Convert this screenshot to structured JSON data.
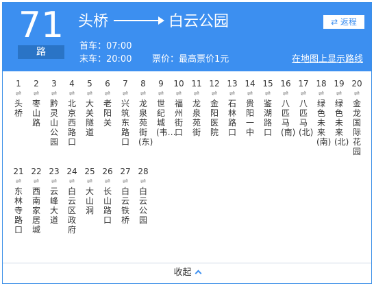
{
  "header": {
    "route_number": "71",
    "route_suffix": "路",
    "from": "头桥",
    "to": "白云公园",
    "first_bus": "首车：07:00",
    "last_bus": "末车：20:00",
    "price": "票价：最高票价1元",
    "map_link": "在地图上显示路线",
    "return_label": "⇄ 返程"
  },
  "dir_glyph": "⇌",
  "stops": [
    {
      "num": "1",
      "name": "头桥"
    },
    {
      "num": "2",
      "name": "枣山路"
    },
    {
      "num": "3",
      "name": "黔灵山公园"
    },
    {
      "num": "4",
      "name": "北京西路口"
    },
    {
      "num": "5",
      "name": "大关隧道"
    },
    {
      "num": "6",
      "name": "老阳关"
    },
    {
      "num": "7",
      "name": "兴筑东路口"
    },
    {
      "num": "8",
      "name": "龙泉苑街(东)"
    },
    {
      "num": "9",
      "name": "世纪城(韦…"
    },
    {
      "num": "10",
      "name": "福州街口"
    },
    {
      "num": "11",
      "name": "龙泉苑街"
    },
    {
      "num": "12",
      "name": "金阳医院"
    },
    {
      "num": "13",
      "name": "石林路口"
    },
    {
      "num": "14",
      "name": "贵阳一中"
    },
    {
      "num": "15",
      "name": "鉴湖路口"
    },
    {
      "num": "16",
      "name": "八匹马(南)"
    },
    {
      "num": "17",
      "name": "八匹马(北)"
    },
    {
      "num": "18",
      "name": "绿色未来(南)"
    },
    {
      "num": "19",
      "name": "绿色未来(北)"
    },
    {
      "num": "20",
      "name": "金龙国际花园"
    },
    {
      "num": "21",
      "name": "东林寺路口"
    },
    {
      "num": "22",
      "name": "西南家居城"
    },
    {
      "num": "23",
      "name": "云峰大道"
    },
    {
      "num": "24",
      "name": "白云区政府"
    },
    {
      "num": "25",
      "name": "大山洞"
    },
    {
      "num": "26",
      "name": "长山路口"
    },
    {
      "num": "27",
      "name": "白云铁桥"
    },
    {
      "num": "28",
      "name": "白云公园"
    }
  ],
  "footer": {
    "collapse_label": "收起"
  }
}
